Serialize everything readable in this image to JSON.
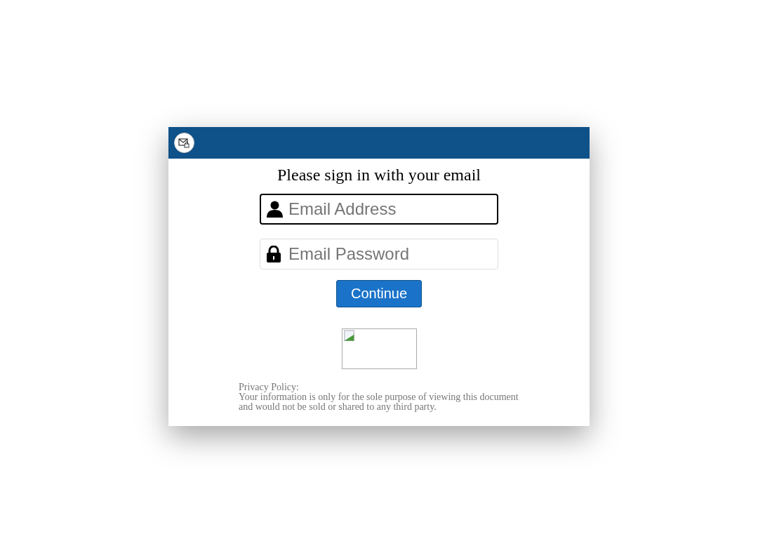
{
  "heading": "Please sign in with your email",
  "fields": [
    {
      "kind": "user",
      "placeholder": "Email Address",
      "focused": true
    },
    {
      "kind": "lock",
      "placeholder": "Email Password",
      "focused": false
    }
  ],
  "button": "Continue",
  "image": {
    "kind": "broken-image"
  },
  "privacy": {
    "title": "Privacy Policy:",
    "lines": [
      "Your information is only for the sole purpose of viewing this document",
      "and would not be sold or shared to any third party."
    ]
  }
}
